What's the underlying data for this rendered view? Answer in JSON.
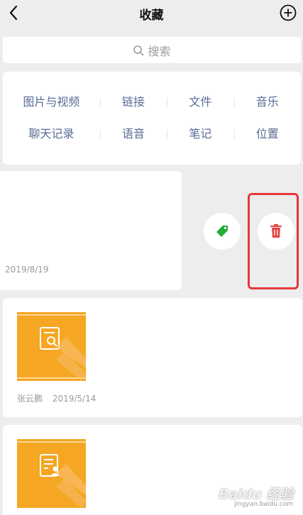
{
  "header": {
    "title": "收藏",
    "back_icon": "chevron-left-icon",
    "add_icon": "plus-circle-icon"
  },
  "search": {
    "placeholder": "搜索",
    "icon": "search-icon"
  },
  "categories": {
    "row1": [
      "图片与视频",
      "链接",
      "文件",
      "音乐"
    ],
    "row2": [
      "聊天记录",
      "语音",
      "笔记",
      "位置"
    ]
  },
  "items": [
    {
      "date": "2019/8/19"
    },
    {
      "author": "张云鹏",
      "date": "2019/5/14"
    },
    {
      "author": "",
      "date": ""
    }
  ],
  "swipe_actions": {
    "tag_icon": "tag-icon",
    "delete_icon": "trash-icon",
    "highlight_color": "#e5373a"
  },
  "watermark": {
    "brand": "Baidu 经验",
    "sub": "jingyan.baidu.com"
  },
  "colors": {
    "link": "#576b95",
    "thumb": "#f5a623",
    "tag": "#22ac38",
    "delete": "#e64340"
  }
}
